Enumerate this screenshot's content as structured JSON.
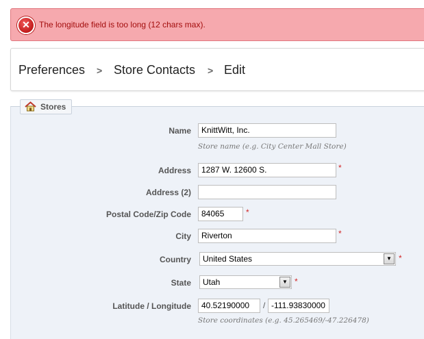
{
  "error": {
    "message": "The longitude field is too long (12 chars max)."
  },
  "breadcrumb": {
    "items": [
      "Preferences",
      "Store Contacts",
      "Edit"
    ],
    "separator": ">"
  },
  "panel": {
    "title": "Stores"
  },
  "form": {
    "name": {
      "label": "Name",
      "value": "KnittWitt, Inc.",
      "hint": "Store name (e.g. City Center Mall Store)"
    },
    "address": {
      "label": "Address",
      "value": "1287 W. 12600 S.",
      "required": "*"
    },
    "address2": {
      "label": "Address (2)",
      "value": ""
    },
    "postal": {
      "label": "Postal Code/Zip Code",
      "value": "84065",
      "required": "*"
    },
    "city": {
      "label": "City",
      "value": "Riverton",
      "required": "*"
    },
    "country": {
      "label": "Country",
      "selected": "United States",
      "required": "*"
    },
    "state": {
      "label": "State",
      "selected": "Utah",
      "required": "*"
    },
    "coords": {
      "label": "Latitude / Longitude",
      "latitude": "40.52190000",
      "longitude": "-111.93830000",
      "separator": "/",
      "hint": "Store coordinates (e.g. 45.265469/-47.226478)"
    }
  },
  "colors": {
    "error_bg": "#f6a9ae",
    "error_text": "#a30d0d",
    "panel_bg": "#eef2f8",
    "required": "#d12626"
  }
}
